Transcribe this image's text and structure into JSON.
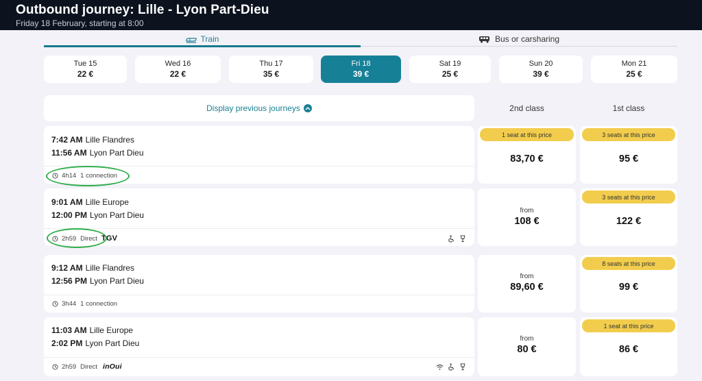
{
  "header": {
    "title": "Outbound journey: Lille - Lyon Part-Dieu",
    "subtitle": "Friday 18 February, starting at 8:00"
  },
  "mode_tabs": [
    {
      "label": "Train",
      "icon": "train-icon",
      "active": true
    },
    {
      "label": "Bus or carsharing",
      "icon": "bus-icon",
      "active": false
    }
  ],
  "dates": [
    {
      "day": "Tue 15",
      "price": "22 €",
      "active": false
    },
    {
      "day": "Wed 16",
      "price": "22 €",
      "active": false
    },
    {
      "day": "Thu 17",
      "price": "35 €",
      "active": false
    },
    {
      "day": "Fri 18",
      "price": "39 €",
      "active": true
    },
    {
      "day": "Sat 19",
      "price": "25 €",
      "active": false
    },
    {
      "day": "Sun 20",
      "price": "39 €",
      "active": false
    },
    {
      "day": "Mon 21",
      "price": "25 €",
      "active": false
    }
  ],
  "previous_journeys_label": "Display previous journeys",
  "class_headers": {
    "second": "2nd class",
    "first": "1st class"
  },
  "journeys": [
    {
      "dep_time": "7:42 AM",
      "dep_station": "Lille Flandres",
      "arr_time": "11:56 AM",
      "arr_station": "Lyon Part Dieu",
      "duration": "4h14",
      "connections": "1 connection",
      "brand": "",
      "second": {
        "badge": "1 seat at this price",
        "from": "",
        "price": "83,70 €"
      },
      "first": {
        "badge": "3 seats at this price",
        "from": "",
        "price": "95 €"
      }
    },
    {
      "dep_time": "9:01 AM",
      "dep_station": "Lille Europe",
      "arr_time": "12:00 PM",
      "arr_station": "Lyon Part Dieu",
      "duration": "2h59",
      "connections": "Direct",
      "brand": "TGV",
      "second": {
        "badge": "",
        "from": "from",
        "price": "108 €"
      },
      "first": {
        "badge": "3 seats at this price",
        "from": "",
        "price": "122 €"
      }
    },
    {
      "dep_time": "9:12 AM",
      "dep_station": "Lille Flandres",
      "arr_time": "12:56 PM",
      "arr_station": "Lyon Part Dieu",
      "duration": "3h44",
      "connections": "1 connection",
      "brand": "",
      "second": {
        "badge": "",
        "from": "from",
        "price": "89,60 €"
      },
      "first": {
        "badge": "8 seats at this price",
        "from": "",
        "price": "99 €"
      }
    },
    {
      "dep_time": "11:03 AM",
      "dep_station": "Lille Europe",
      "arr_time": "2:02 PM",
      "arr_station": "Lyon Part Dieu",
      "duration": "2h59",
      "connections": "Direct",
      "brand": "inOui",
      "second": {
        "badge": "",
        "from": "from",
        "price": "80 €"
      },
      "first": {
        "badge": "1 seat at this price",
        "from": "",
        "price": "86 €"
      }
    }
  ],
  "colors": {
    "accent": "#168097",
    "badge": "#f2cd4d",
    "header_bg": "#0c131f",
    "annotation": "#2fae4a"
  }
}
